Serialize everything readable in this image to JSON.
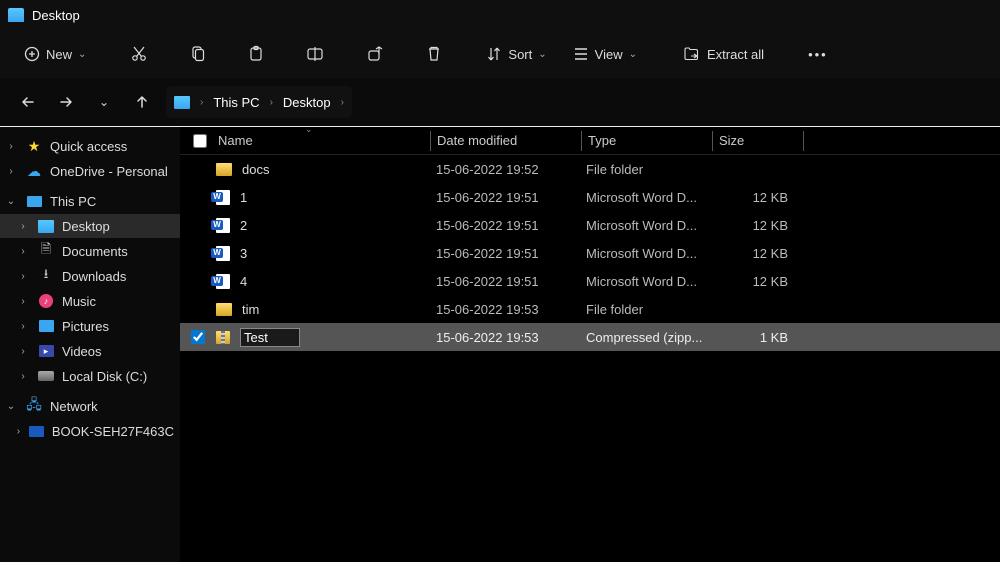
{
  "window": {
    "title": "Desktop"
  },
  "toolbar": {
    "new_label": "New",
    "sort_label": "Sort",
    "view_label": "View",
    "extract_label": "Extract all"
  },
  "breadcrumb": {
    "root": "This PC",
    "folder": "Desktop"
  },
  "sidebar": {
    "quick_access": "Quick access",
    "onedrive": "OneDrive - Personal",
    "this_pc": "This PC",
    "desktop": "Desktop",
    "documents": "Documents",
    "downloads": "Downloads",
    "music": "Music",
    "pictures": "Pictures",
    "videos": "Videos",
    "local_disk": "Local Disk (C:)",
    "network": "Network",
    "pc_name": "BOOK-SEH27F463C"
  },
  "columns": {
    "name": "Name",
    "date": "Date modified",
    "type": "Type",
    "size": "Size"
  },
  "rows": [
    {
      "name": "docs",
      "date": "15-06-2022 19:52",
      "type": "File folder",
      "size": "",
      "kind": "folder"
    },
    {
      "name": "1",
      "date": "15-06-2022 19:51",
      "type": "Microsoft Word D...",
      "size": "12 KB",
      "kind": "word"
    },
    {
      "name": "2",
      "date": "15-06-2022 19:51",
      "type": "Microsoft Word D...",
      "size": "12 KB",
      "kind": "word"
    },
    {
      "name": "3",
      "date": "15-06-2022 19:51",
      "type": "Microsoft Word D...",
      "size": "12 KB",
      "kind": "word"
    },
    {
      "name": "4",
      "date": "15-06-2022 19:51",
      "type": "Microsoft Word D...",
      "size": "12 KB",
      "kind": "word"
    },
    {
      "name": "tim",
      "date": "15-06-2022 19:53",
      "type": "File folder",
      "size": "",
      "kind": "folder"
    },
    {
      "name": "Test",
      "date": "15-06-2022 19:53",
      "type": "Compressed (zipp...",
      "size": "1 KB",
      "kind": "zip",
      "selected": true,
      "renaming": true
    }
  ]
}
